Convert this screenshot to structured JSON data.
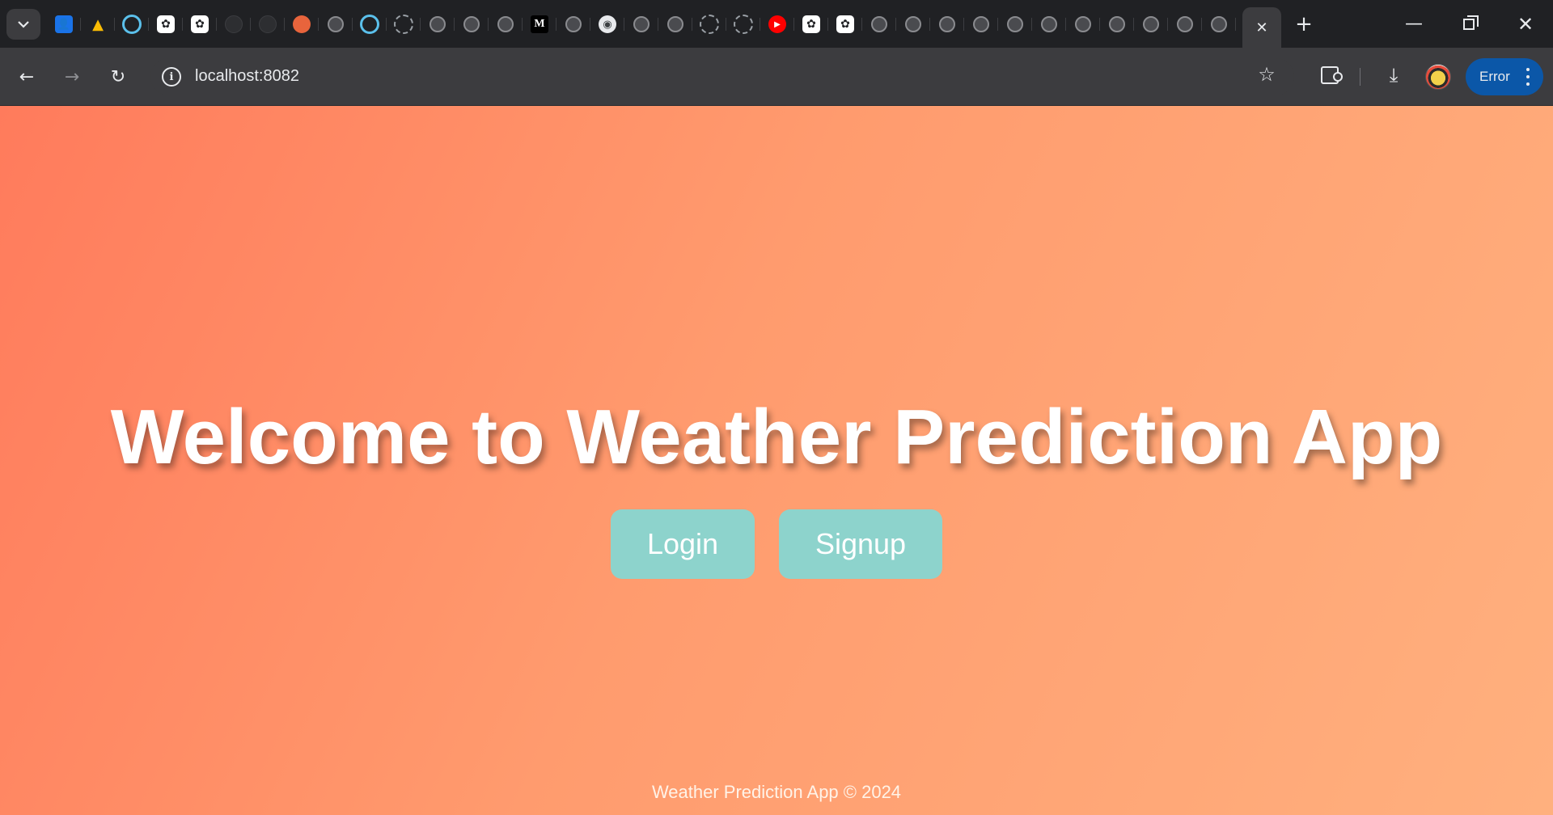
{
  "browser": {
    "tab_favicons": [
      "contacts-icon",
      "drive-icon",
      "ring-icon",
      "chatgpt-icon",
      "chatgpt-icon",
      "github-icon",
      "github-icon",
      "orange-blob-icon",
      "globe-icon",
      "ring-icon",
      "dashed-ring-icon",
      "globe-icon",
      "blue-circle-icon",
      "globe-icon",
      "medium-icon",
      "globe-icon",
      "chrome-icon",
      "globe-icon",
      "globe-icon",
      "dashed-ring-icon",
      "dashed-ring-icon",
      "youtube-icon",
      "chatgpt-icon",
      "chatgpt-icon",
      "globe-icon",
      "globe-icon",
      "globe-icon",
      "globe-icon",
      "globe-icon",
      "globe-icon",
      "globe-icon",
      "globe-icon",
      "globe-icon",
      "globe-icon",
      "globe-icon"
    ],
    "address": "localhost:8082",
    "profile_status": "Error",
    "colors": {
      "frame": "#202124",
      "toolbar": "#3c3c3f",
      "error_pill": "#0b57a8"
    }
  },
  "page": {
    "title": "Welcome to Weather Prediction App",
    "login_label": "Login",
    "signup_label": "Signup",
    "footer": "Weather Prediction App © 2024",
    "colors": {
      "gradient_start": "#ff7b5c",
      "gradient_end": "#ffb07e",
      "button_bg": "#8dd3cc",
      "text": "#ffffff"
    }
  }
}
